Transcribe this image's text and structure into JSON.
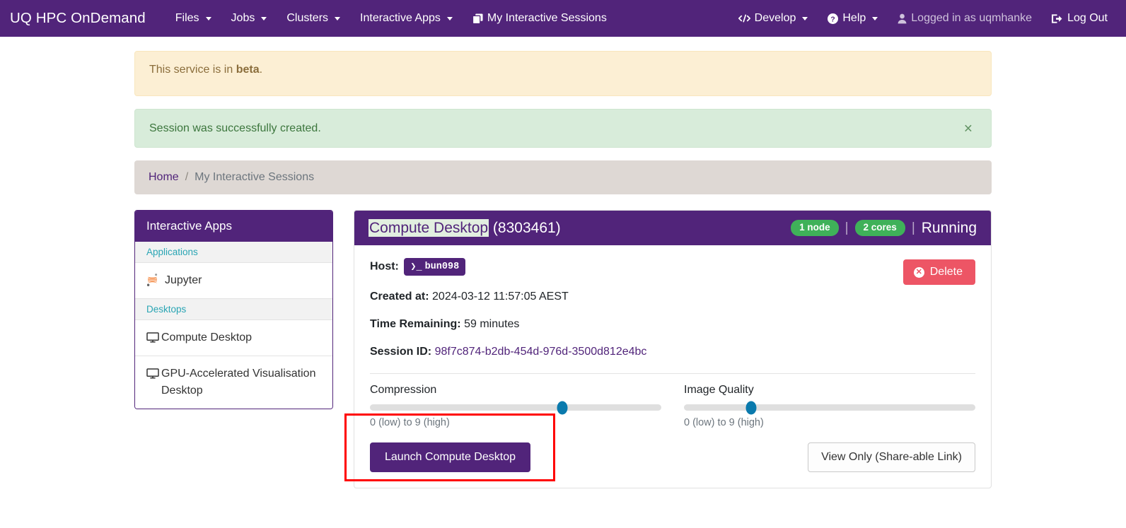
{
  "navbar": {
    "brand": "UQ HPC OnDemand",
    "items": [
      {
        "label": "Files",
        "has_caret": true,
        "icon": ""
      },
      {
        "label": "Jobs",
        "has_caret": true,
        "icon": ""
      },
      {
        "label": "Clusters",
        "has_caret": true,
        "icon": ""
      },
      {
        "label": "Interactive Apps",
        "has_caret": true,
        "icon": ""
      },
      {
        "label": "My Interactive Sessions",
        "has_caret": false,
        "icon": "windows-stack-icon"
      }
    ],
    "right_items": [
      {
        "label": "Develop",
        "has_caret": true,
        "icon": "code-icon"
      },
      {
        "label": "Help",
        "has_caret": true,
        "icon": "question-circle-icon"
      },
      {
        "label": "Logged in as uqmhanke",
        "has_caret": false,
        "icon": "user-icon"
      },
      {
        "label": "Log Out",
        "has_caret": false,
        "icon": "logout-icon"
      }
    ]
  },
  "alerts": {
    "beta": {
      "text_before": "This service is in ",
      "bold": "beta",
      "text_after": "."
    },
    "success": {
      "text": "Session was successfully created.",
      "close_label": "×"
    }
  },
  "breadcrumb": {
    "home": "Home",
    "separator": "/",
    "current": "My Interactive Sessions"
  },
  "sidebar": {
    "header": "Interactive Apps",
    "groups": [
      {
        "title": "Applications",
        "items": [
          {
            "label": "Jupyter",
            "icon": "jupyter-icon"
          }
        ]
      },
      {
        "title": "Desktops",
        "items": [
          {
            "label": "Compute Desktop",
            "icon": "desktop-icon"
          },
          {
            "label": "GPU-Accelerated Visualisation Desktop",
            "icon": "desktop-icon"
          }
        ]
      }
    ]
  },
  "session": {
    "title_highlighted": "Compute Desktop",
    "title_id": " (8303461)",
    "badges": [
      "1 node",
      "2 cores"
    ],
    "separator": "|",
    "status": "Running",
    "fields": {
      "host_label": "Host:",
      "host_value": "bun098",
      "host_prompt": "❯_",
      "created_label": "Created at:",
      "created_value": "2024-03-12 11:57:05 AEST",
      "time_label": "Time Remaining:",
      "time_value": "59 minutes",
      "session_label": "Session ID:",
      "session_value": "98f7c874-b2db-454d-976d-3500d812e4bc"
    },
    "delete_button": "Delete",
    "sliders": [
      {
        "label": "Compression",
        "help": "0 (low) to 9 (high)",
        "percent": 66
      },
      {
        "label": "Image Quality",
        "help": "0 (low) to 9 (high)",
        "percent": 23
      }
    ],
    "launch_button": "Launch Compute Desktop",
    "view_only_button": "View Only (Share-able Link)"
  },
  "colors": {
    "brand_purple": "#51247a",
    "badge_green": "#3fb159",
    "delete_red": "#ed5565",
    "slider_blue": "#0a7aad",
    "annotation_red": "#ff0000"
  }
}
